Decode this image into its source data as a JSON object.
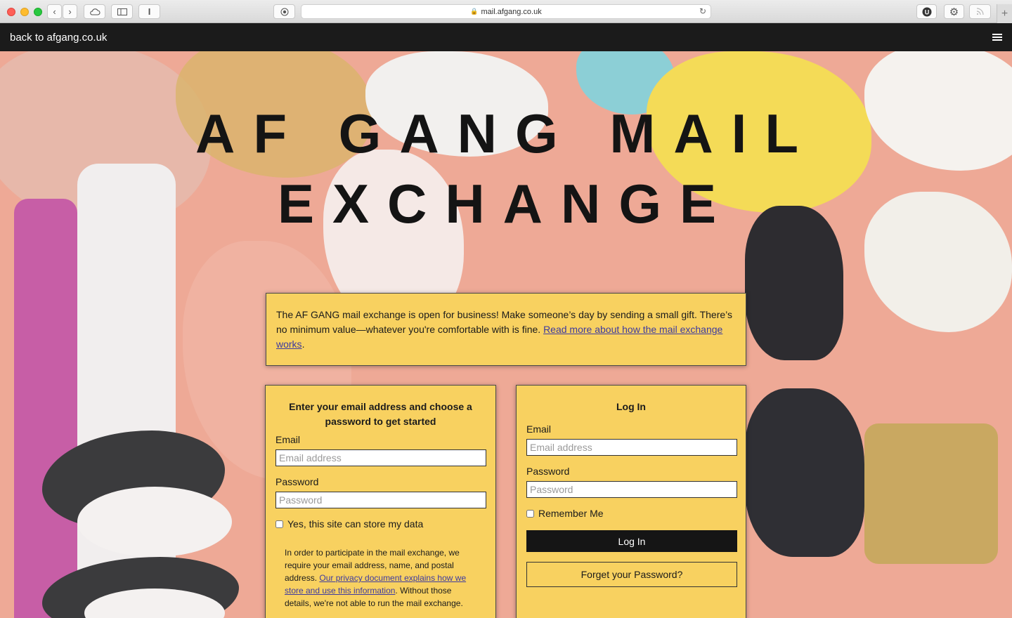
{
  "browser": {
    "url": "mail.afgang.co.uk"
  },
  "nav": {
    "back_link": "back to afgang.co.uk"
  },
  "hero": {
    "title_line1": "AF GANG MAIL",
    "title_line2": "EXCHANGE"
  },
  "notice": {
    "text": "The AF GANG mail exchange is open for business! Make someone’s day by sending a small gift. There’s no minimum value—whatever you're comfortable with is fine. ",
    "link": "Read more about how the mail exchange works",
    "end": "."
  },
  "signup": {
    "title": "Enter your email address and choose a password to get started",
    "email_label": "Email",
    "email_placeholder": "Email address",
    "password_label": "Password",
    "password_placeholder": "Password",
    "consent_label": "Yes, this site can store my data",
    "privacy_text_1": "In order to participate in the mail exchange, we require your email address, name, and postal address. ",
    "privacy_link": "Our privacy document explains how we store and use this information",
    "privacy_text_2": ". Without those details, we're not able to run the mail exchange."
  },
  "login": {
    "title": "Log In",
    "email_label": "Email",
    "email_placeholder": "Email address",
    "password_label": "Password",
    "password_placeholder": "Password",
    "remember_label": "Remember Me",
    "login_button": "Log In",
    "forgot_button": "Forget your Password?"
  }
}
